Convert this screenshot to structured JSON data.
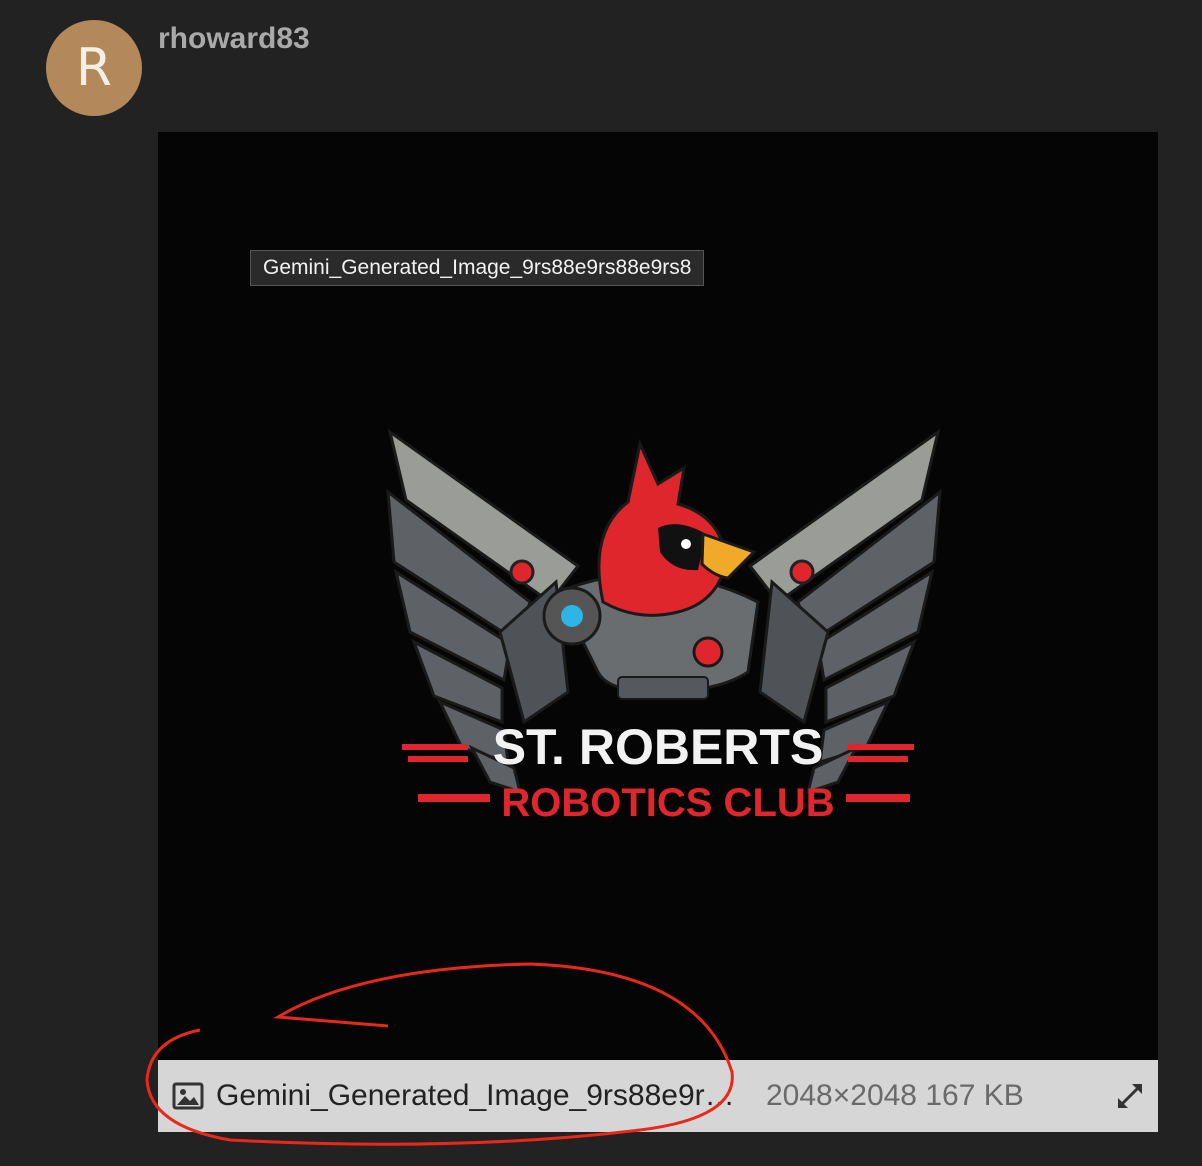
{
  "post": {
    "avatar_letter": "R",
    "username": "rhoward83"
  },
  "image": {
    "tooltip": "Gemini_Generated_Image_9rs88e9rs88e9rs8",
    "logo_line1": "ST. ROBERTS",
    "logo_line2": "ROBOTICS CLUB",
    "caption_filename": "Gemini_Generated_Image_9rs88e9rs88e9rs8",
    "caption_meta": "2048×2048 167 KB"
  },
  "icons": {
    "image": "image-icon",
    "expand": "expand-icon"
  },
  "colors": {
    "background": "#222222",
    "avatar": "#b3895c",
    "logo_red": "#e0262d",
    "annotation_red": "#e8291a"
  }
}
